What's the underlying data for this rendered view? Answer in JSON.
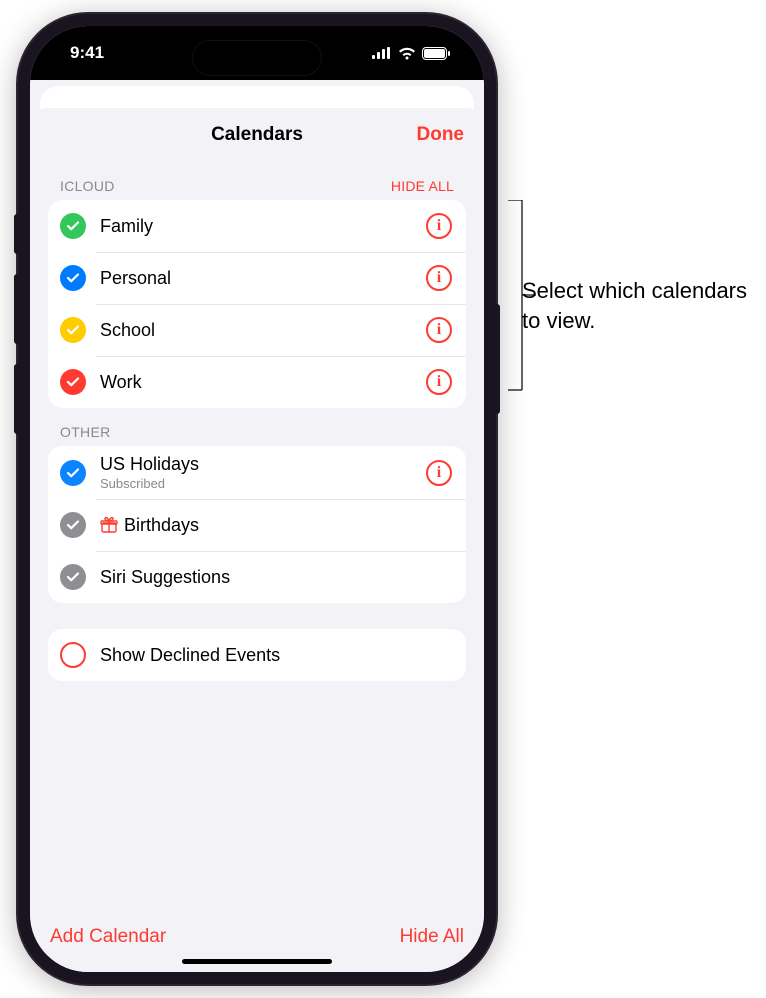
{
  "status": {
    "time": "9:41"
  },
  "header": {
    "title": "Calendars",
    "done": "Done"
  },
  "sections": {
    "icloud": {
      "label": "ICLOUD",
      "action": "HIDE ALL",
      "items": [
        {
          "name": "Family",
          "color": "#34c759",
          "checked": true
        },
        {
          "name": "Personal",
          "color": "#007aff",
          "checked": true
        },
        {
          "name": "School",
          "color": "#ffcc00",
          "checked": true
        },
        {
          "name": "Work",
          "color": "#ff3b30",
          "checked": true
        }
      ]
    },
    "other": {
      "label": "OTHER",
      "items": [
        {
          "name": "US Holidays",
          "sub": "Subscribed",
          "color": "#0a84ff",
          "checked": true,
          "info": true
        },
        {
          "name": "Birthdays",
          "color": "#8e8e93",
          "checked": true,
          "gift": true
        },
        {
          "name": "Siri Suggestions",
          "color": "#8e8e93",
          "checked": true
        }
      ]
    },
    "declined": {
      "label": "Show Declined Events"
    }
  },
  "toolbar": {
    "add": "Add Calendar",
    "hide": "Hide All"
  },
  "callout": {
    "text": "Select which calendars to view."
  }
}
